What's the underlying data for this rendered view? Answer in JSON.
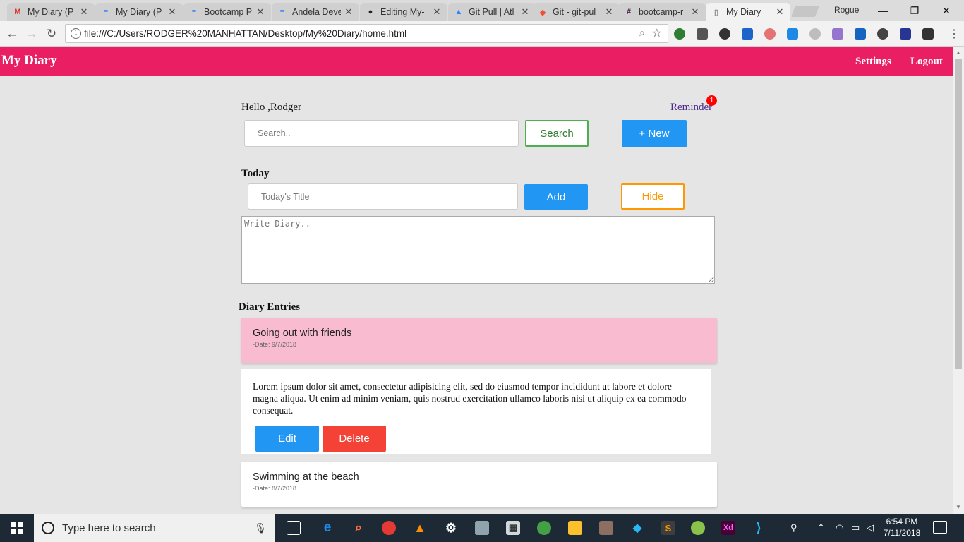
{
  "browser": {
    "tabs": [
      {
        "title": "My Diary (P",
        "icon": "gmail-icon",
        "color": "#d93025",
        "glyph": "M"
      },
      {
        "title": "My Diary (P",
        "icon": "google-docs-icon",
        "color": "#4285f4",
        "glyph": "≡"
      },
      {
        "title": "Bootcamp P",
        "icon": "google-docs-icon",
        "color": "#4285f4",
        "glyph": "≡"
      },
      {
        "title": "Andela Deve",
        "icon": "google-docs-icon",
        "color": "#4285f4",
        "glyph": "≡"
      },
      {
        "title": "Editing My-",
        "icon": "github-icon",
        "color": "#222222",
        "glyph": "●"
      },
      {
        "title": "Git Pull | Atl",
        "icon": "atlassian-icon",
        "color": "#2684ff",
        "glyph": "▲"
      },
      {
        "title": "Git - git-pul",
        "icon": "git-icon",
        "color": "#f05033",
        "glyph": "◆"
      },
      {
        "title": "bootcamp-r",
        "icon": "slack-icon",
        "color": "#4a154b",
        "glyph": "#"
      },
      {
        "title": "My Diary",
        "icon": "page-icon",
        "color": "#888888",
        "glyph": "▯"
      }
    ],
    "profile_name": "Rogue",
    "url": "file:///C:/Users/RODGER%20MANHATTAN/Desktop/My%20Diary/home.html"
  },
  "navbar": {
    "brand": "My Diary",
    "settings": "Settings",
    "logout": "Logout",
    "color": "#e91e63"
  },
  "main": {
    "greeting": "Hello ,Rodger",
    "reminder_label": "Reminder",
    "reminder_count": "1",
    "search_placeholder": "Search..",
    "search_button": "Search",
    "new_button": "+ New",
    "today_heading": "Today",
    "title_placeholder": "Today's Title",
    "add_button": "Add",
    "hide_button": "Hide",
    "diary_placeholder": "Write Diary..",
    "entries_heading": "Diary Entries"
  },
  "entries": [
    {
      "title": "Going out with friends",
      "date": "-Date: 9/7/2018",
      "bg": "#f8bbd0"
    },
    {
      "title": "Swimming at the beach",
      "date": "-Date: 8/7/2018",
      "bg": "#ffffff"
    }
  ],
  "expanded_entry": {
    "text": "Lorem ipsum dolor sit amet, consectetur adipisicing elit, sed do eiusmod tempor incididunt ut labore et dolore magna aliqua. Ut enim ad minim veniam, quis nostrud exercitation ullamco laboris nisi ut aliquip ex ea commodo consequat.",
    "edit_button": "Edit",
    "delete_button": "Delete"
  },
  "taskbar": {
    "search_text": "Type here to search",
    "time": "6:54 PM",
    "date": "7/11/2018"
  }
}
